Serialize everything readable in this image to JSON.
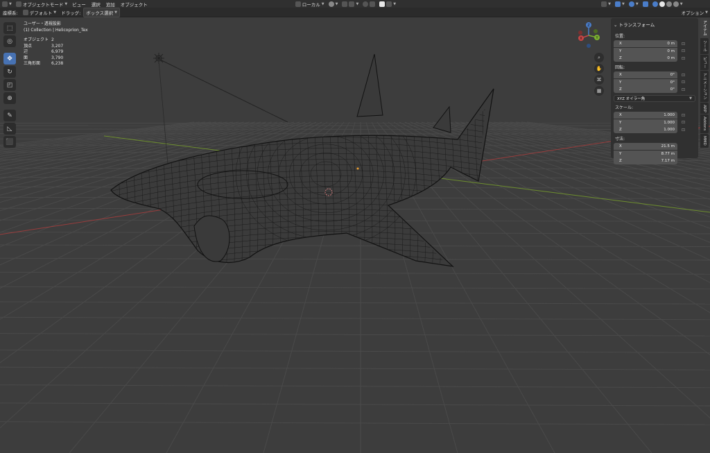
{
  "header_top": {
    "mode": "オブジェクトモード",
    "menu": [
      "ビュー",
      "選択",
      "追加",
      "オブジェクト"
    ],
    "transform_orientation": "ローカル"
  },
  "header_bottom": {
    "coord_label": "座標系:",
    "coord_value": "デフォルト",
    "drag_label": "ドラッグ:",
    "drag_value": "ボックス選択",
    "options": "オプション"
  },
  "overlay": {
    "view": "ユーザー・透視投影",
    "collection": "(1) Collection | Helicoprion_Tex",
    "stats": [
      {
        "label": "オブジェクト",
        "value": "2"
      },
      {
        "label": "頂点",
        "value": "3,207"
      },
      {
        "label": "辺",
        "value": "6,979"
      },
      {
        "label": "面",
        "value": "3,790"
      },
      {
        "label": "三角形面",
        "value": "6,238"
      }
    ]
  },
  "gizmo": {
    "x": "X",
    "y": "Y",
    "z": "Z"
  },
  "npanel": {
    "title": "トランスフォーム",
    "location_label": "位置:",
    "location": [
      {
        "axis": "X",
        "value": "0 m"
      },
      {
        "axis": "Y",
        "value": "0 m"
      },
      {
        "axis": "Z",
        "value": "0 m"
      }
    ],
    "rotation_label": "回転:",
    "rotation": [
      {
        "axis": "X",
        "value": "0°"
      },
      {
        "axis": "Y",
        "value": "0°"
      },
      {
        "axis": "Z",
        "value": "0°"
      }
    ],
    "rotation_mode": "XYZ オイラー角",
    "scale_label": "スケール:",
    "scale": [
      {
        "axis": "X",
        "value": "1.000"
      },
      {
        "axis": "Y",
        "value": "1.000"
      },
      {
        "axis": "Z",
        "value": "1.000"
      }
    ],
    "dimensions_label": "寸法:",
    "dimensions": [
      {
        "axis": "X",
        "value": "21.5 m"
      },
      {
        "axis": "Y",
        "value": "8.77 m"
      },
      {
        "axis": "Z",
        "value": "7.17 m"
      }
    ]
  },
  "side_tabs": [
    "アイテム",
    "ツール",
    "ビュー",
    "アニメーション",
    "ARP",
    "Addons",
    "MMD"
  ],
  "colors": {
    "x_axis": "#b03a3a",
    "y_axis": "#7aa030",
    "accent": "#4772b3"
  }
}
